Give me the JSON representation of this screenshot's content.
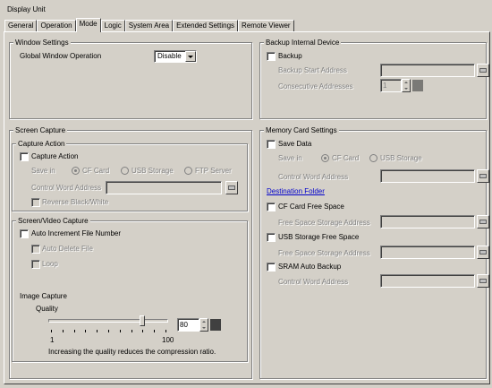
{
  "window_title": "Display Unit",
  "tabs": [
    {
      "label": "General"
    },
    {
      "label": "Operation"
    },
    {
      "label": "Mode"
    },
    {
      "label": "Logic"
    },
    {
      "label": "System Area"
    },
    {
      "label": "Extended Settings"
    },
    {
      "label": "Remote Viewer"
    }
  ],
  "active_tab": "Mode",
  "window_settings": {
    "title": "Window Settings",
    "global_label": "Global Window Operation",
    "global_value": "Disable"
  },
  "screen_capture": {
    "title": "Screen Capture",
    "capture_action": {
      "title": "Capture Action",
      "checkbox_label": "Capture Action",
      "save_in_label": "Save in",
      "options": [
        "CF Card",
        "USB Storage",
        "FTP Server"
      ],
      "control_word_label": "Control Word Address",
      "reverse_label": "Reverse Black/White"
    },
    "screen_video": {
      "title": "Screen/Video Capture",
      "auto_increment_label": "Auto Increment File Number",
      "auto_delete_label": "Auto Delete File",
      "loop_label": "Loop",
      "image_capture_label": "Image Capture",
      "quality_label": "Quality",
      "quality_value": "80",
      "quality_fraction": 0.8,
      "min_label": "1",
      "max_label": "100",
      "note": "Increasing the quality reduces the compression ratio."
    }
  },
  "backup": {
    "title": "Backup Internal Device",
    "checkbox_label": "Backup",
    "start_address_label": "Backup Start Address",
    "consecutive_label": "Consecutive Addresses",
    "consecutive_value": "1"
  },
  "memory_card": {
    "title": "Memory Card Settings",
    "save_data_label": "Save Data",
    "save_in_label": "Save in",
    "options": [
      "CF Card",
      "USB Storage"
    ],
    "control_word_label": "Control Word Address",
    "destination_link": "Destination Folder",
    "cf_free_label": "CF Card Free Space",
    "cf_free_storage_label": "Free Space Storage Address",
    "usb_free_label": "USB Storage Free Space",
    "usb_free_storage_label": "Free Space Storage Address",
    "sram_label": "SRAM Auto Backup",
    "sram_control_label": "Control Word Address"
  }
}
